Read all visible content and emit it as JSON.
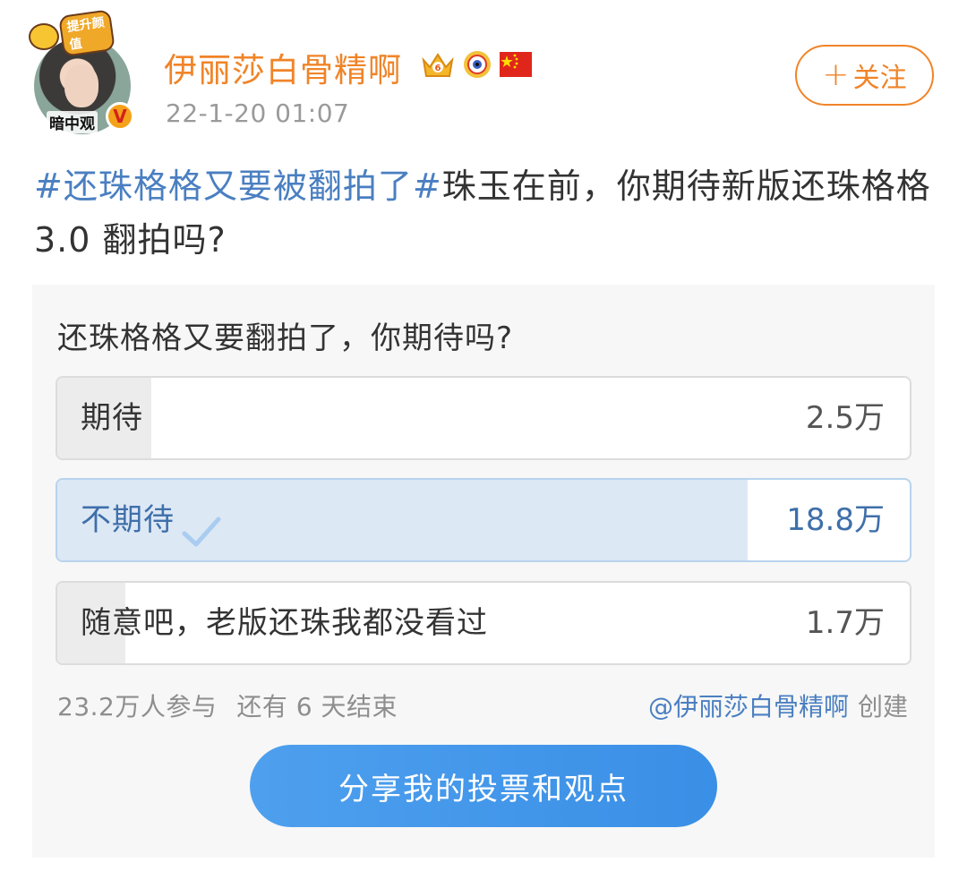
{
  "post": {
    "avatar": {
      "caption": "暗中观",
      "pendant_text": "提升颜值"
    },
    "username": "伊丽莎白骨精啊",
    "timestamp": "22-1-20 01:07",
    "badges": [
      "crown-badge-icon",
      "eye-badge-icon",
      "china-flag-icon"
    ],
    "follow": {
      "plus": "+",
      "label": "关注"
    },
    "text": {
      "topic": "#还珠格格又要被翻拍了#",
      "body": "珠玉在前，你期待新版还珠格格 3.0 翻拍吗?"
    }
  },
  "poll": {
    "question": "还珠格格又要翻拍了，你期待吗?",
    "options": [
      {
        "label": "期待",
        "count": "2.5万",
        "share": 0.11,
        "selected": false
      },
      {
        "label": "不期待",
        "count": "18.8万",
        "share": 0.81,
        "selected": true
      },
      {
        "label": "随意吧，老版还珠我都没看过",
        "count": "1.7万",
        "share": 0.08,
        "selected": false
      }
    ],
    "participants": "23.2万人参与",
    "remaining": "还有 6 天结束",
    "creator_user": "@伊丽莎白骨精啊",
    "creator_suffix": "创建",
    "share_button": "分享我的投票和观点"
  },
  "colors": {
    "brand_orange": "#f08428",
    "link_blue": "#4a7fc1",
    "selected_fill": "#dde8f5",
    "button_blue": "#3a8fe6"
  }
}
